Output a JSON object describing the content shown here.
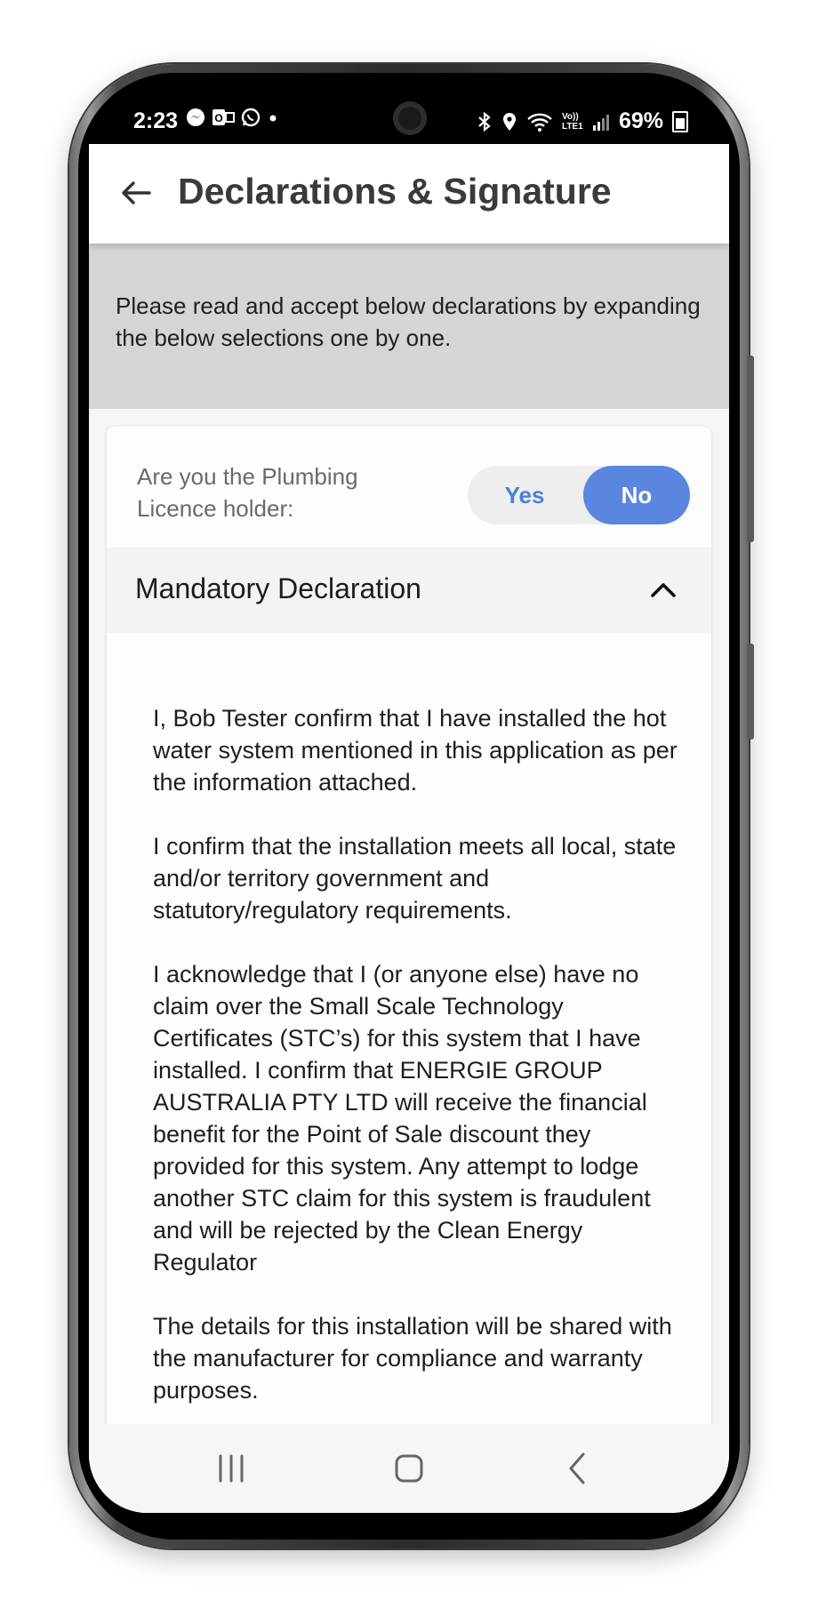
{
  "status_bar": {
    "time": "2:23",
    "battery": "69%",
    "network_label": "Vo)) LTE1",
    "left_icons": [
      "messenger-icon",
      "outlook-icon",
      "whatsapp-icon",
      "dot-icon"
    ],
    "right_icons": [
      "bluetooth-icon",
      "location-icon",
      "wifi-icon",
      "signal-icon",
      "battery-icon"
    ]
  },
  "header": {
    "title": "Declarations & Signature",
    "back_icon": "arrow-left-icon"
  },
  "info": {
    "text": "Please read and accept below declarations by expanding the below selections one by one."
  },
  "licence_question": {
    "label": "Are you the Plumbing Licence holder:",
    "options": [
      "Yes",
      "No"
    ],
    "selected": "No"
  },
  "accordion": {
    "title": "Mandatory Declaration",
    "expanded": true,
    "paragraphs": [
      "I, Bob Tester confirm that I have installed the hot water system mentioned in this application as per the information attached.",
      "I confirm that the installation meets all local, state and/or territory government and statutory/regulatory requirements.",
      "I acknowledge that I (or anyone else) have no claim over the Small Scale Technology Certificates (STC’s) for this system that I have installed. I confirm that ENERGIE GROUP AUSTRALIA PTY LTD will receive the financial benefit for the Point of Sale discount they provided for this system. Any attempt to lodge another STC claim for this system is fraudulent and will be rejected by the Clean Energy Regulator",
      "The details for this installation will be shared with the manufacturer for compliance and warranty purposes."
    ]
  },
  "nav": {
    "icons": [
      "recents-icon",
      "home-icon",
      "back-icon"
    ]
  },
  "colors": {
    "accent": "#5a86e0",
    "header_text": "#3a3a3a",
    "info_band": "#d5d5d5"
  }
}
